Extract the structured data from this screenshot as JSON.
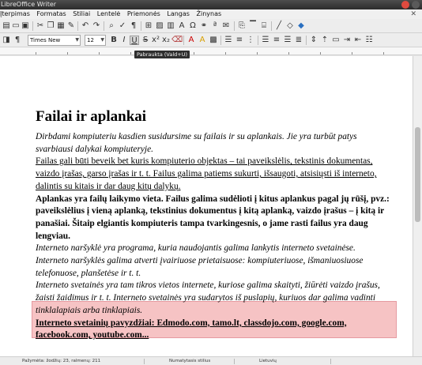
{
  "window": {
    "title": "LibreOffice Writer"
  },
  "menu": [
    "Įterpimas",
    "Formatas",
    "Stiliai",
    "Lentelė",
    "Priemonės",
    "Langas",
    "Žinynas"
  ],
  "toolbar": {
    "font_name": "Times New Roman",
    "font_size": "12",
    "tooltip": "Pabraukta (Vald+U)"
  },
  "document": {
    "title": "Failai ir aplankai",
    "lines": [
      "Dirbdami kompiuteriu kasdien susidursime su failais ir su aplankais. Jie yra turbūt patys",
      "svarbiausi dalykai kompiuteryje.",
      "Failas gali būti beveik bet kuris kompiuterio objektas – tai paveikslėlis, tekstinis dokumentas,",
      "vaizdo įrašas, garso įrašas ir t. t. Failus galima patiems sukurti, išsaugoti, atsisiųsti iš interneto,",
      "dalintis su kitais ir dar daug kitų dalykų.",
      "Aplankas yra failų laikymo vieta. Failus galima sudėlioti į kitus aplankus pagal jų rūšį, pvz.:",
      "paveikslėlius į vieną aplanką, tekstinius dokumentus į kitą aplanką, vaizdo įrašus – į kitą ir",
      "panašiai. Šitaip elgiantis kompiuteris tampa tvarkingesnis, o jame rasti failus yra daug",
      "lengviau.",
      "Interneto naršyklė yra programa, kuria naudojantis galima lankytis interneto svetainėse.",
      "Interneto naršyklės galima atverti įvairiuose prietaisuose: kompiuteriuose, išmaniuosiuose",
      "telefonuose, planšetėse ir t. t.",
      "Interneto svetainės yra tam tikros vietos internete, kuriose galima skaityti, žiūrėti vaizdo įrašus,",
      "žaisti žaidimus ir t. t. Interneto svetainės yra sudarytos iš puslapių, kuriuos dar galima vadinti",
      "tinklalapiais arba tinklapiais.",
      "Interneto svetainių pavyzdžiai: Edmodo.com, tamo.lt, classdojo.com, google.com,",
      "facebook.com, youtube.com..."
    ]
  },
  "status": {
    "words": "Pažymėta: žodžių: 23, ralmenų: 211",
    "style": "Numatytasis stilius",
    "language": "Lietuvių"
  },
  "colors": {
    "highlight": "#f6c3c4",
    "titlebar": "#3a3a3a"
  }
}
